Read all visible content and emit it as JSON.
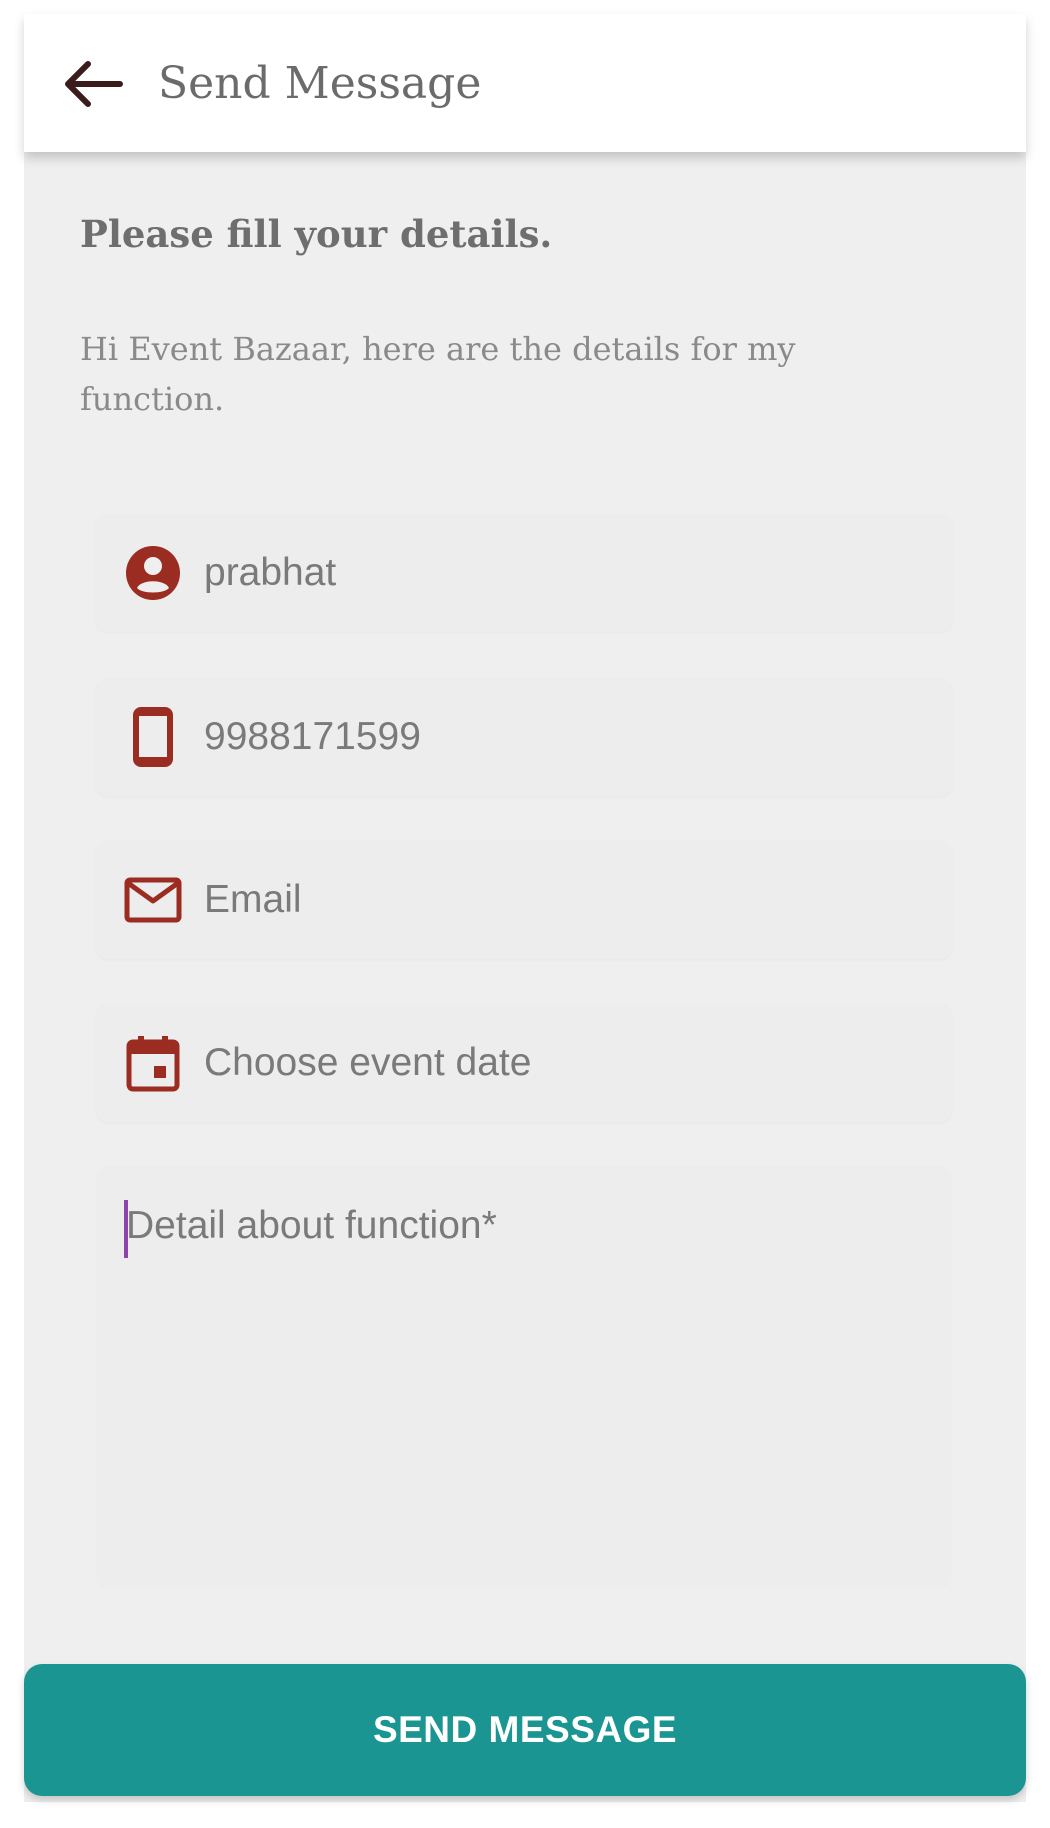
{
  "appbar": {
    "title": "Send Message",
    "back_icon": "arrow-back-icon"
  },
  "form": {
    "heading": "Please fill your details.",
    "intro": "Hi Event Bazaar, here are the details for my function.",
    "fields": {
      "name": {
        "icon": "account-circle-icon",
        "value": "prabhat"
      },
      "phone": {
        "icon": "smartphone-icon",
        "value": "9988171599"
      },
      "email": {
        "icon": "mail-icon",
        "placeholder": "Email"
      },
      "date": {
        "icon": "calendar-icon",
        "placeholder": "Choose event date"
      },
      "detail": {
        "placeholder": "Detail about function*"
      }
    }
  },
  "actions": {
    "send_label": "SEND MESSAGE"
  },
  "colors": {
    "accent": "#1a9591",
    "icon": "#9b2c22",
    "background": "#efeff0",
    "caret": "#8e44ad"
  }
}
